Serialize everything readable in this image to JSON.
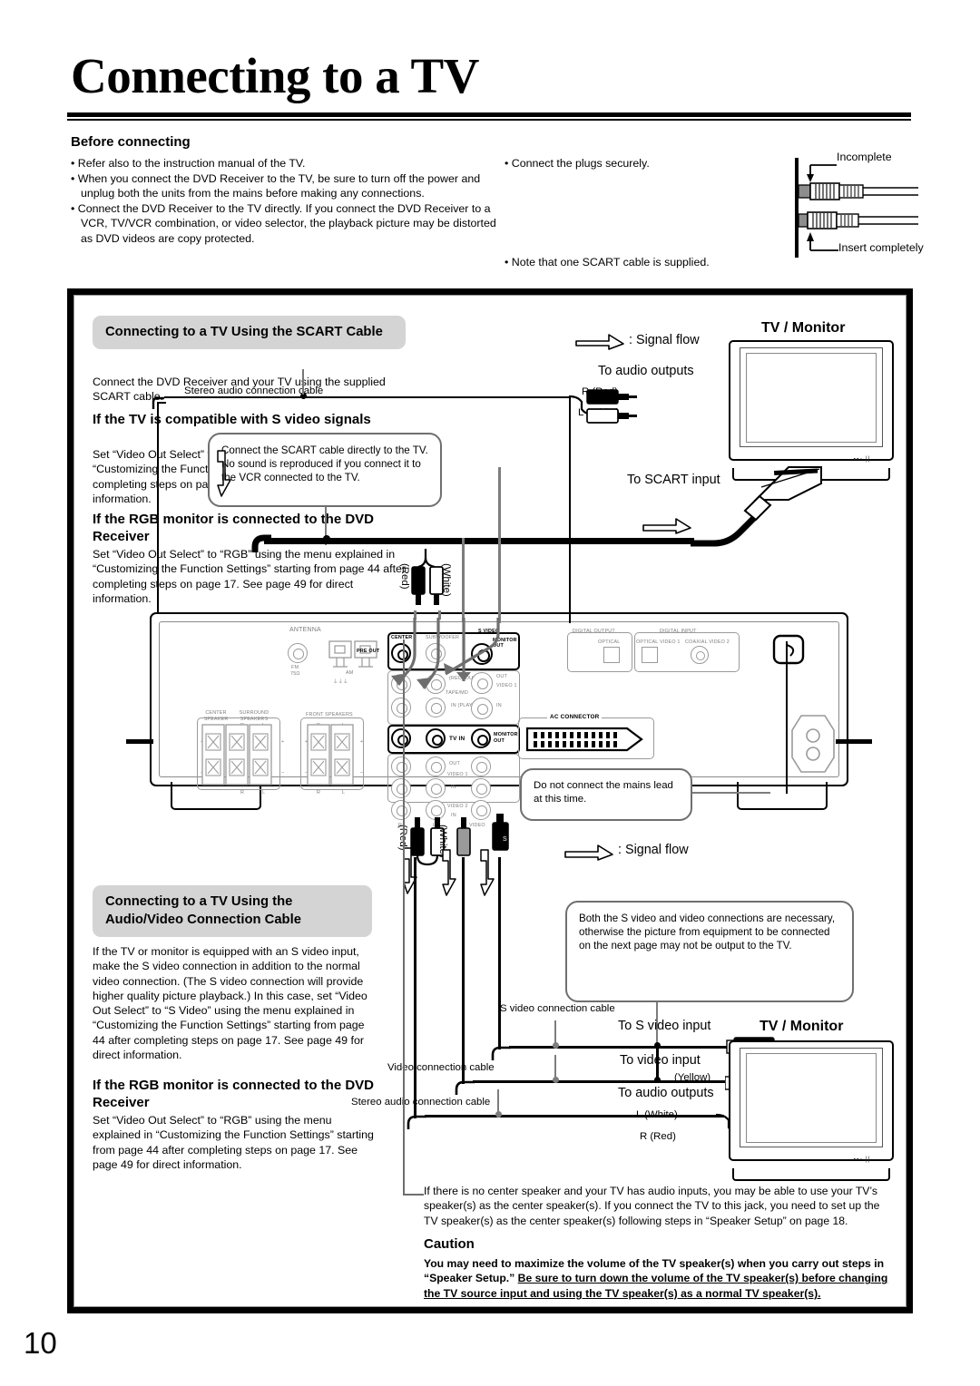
{
  "page": {
    "title": "Connecting to a TV",
    "number": "10"
  },
  "before_connecting": {
    "heading": "Before connecting",
    "left_bullets": [
      "Refer also to the instruction manual of the TV.",
      "When you connect the DVD Receiver to the TV, be sure to turn off the power and unplug both the units from the mains before making any connections.",
      "Connect the DVD Receiver to the TV directly. If you connect the DVD Receiver to a VCR, TV/VCR combination, or video selector, the playback picture may be distorted as DVD videos are copy protected."
    ],
    "right_bullets": [
      "Connect the plugs securely.",
      "Note that one SCART cable is supplied."
    ],
    "plug_diagram": {
      "incomplete_label": "Incomplete",
      "complete_label": "Insert completely"
    }
  },
  "scart_section": {
    "heading": "Connecting to a TV Using the SCART Cable",
    "intro": "Connect the DVD Receiver and your TV using the supplied SCART cable.",
    "sub1_heading": "If the TV is compatible with S video signals",
    "sub1_body": "Set “Video Out Select” to “S Video” using the menu explained in “Customizing the Function Settings” starting from page 44 after completing steps on page 17. See page 49 for direct information.",
    "sub2_heading": "If the RGB monitor is connected to the DVD Receiver",
    "sub2_body": "Set “Video Out Select” to “RGB” using the menu explained in “Customizing the Function Settings” starting from page 44 after completing steps on page 17. See page 49 for direct information."
  },
  "av_section": {
    "heading": "Connecting to a TV Using the Audio/Video Connection Cable",
    "intro": "If the TV or monitor is equipped with an S video input, make the S video connection in addition to the normal video connection. (The S video connection will provide higher quality picture playback.) In this case, set “Video Out Select” to “S Video” using the menu explained in “Customizing the Function Settings” starting from page 44 after completing steps on page 17. See page 49 for direct information.",
    "sub1_heading": "If the RGB monitor is connected to the DVD Receiver",
    "sub1_body": "Set “Video Out Select” to “RGB” using the menu explained in “Customizing the Function Settings” starting from page 44 after completing steps on page 17. See page 49 for direct information."
  },
  "diagram_top": {
    "signal_flow": ": Signal flow",
    "tv_monitor": "TV / Monitor",
    "stereo_cable": "Stereo audio connection cable",
    "to_audio_outputs": "To audio outputs",
    "r_red": "R (Red)",
    "l_white": "L (White)",
    "to_scart_input": "To SCART input",
    "callout": "Connect the SCART cable directly to the TV. No sound is reproduced if you connect it to the VCR connected to the TV.",
    "plug_red": "(Red)",
    "plug_white": "(White)"
  },
  "diagram_bottom": {
    "signal_flow": ": Signal flow",
    "tv_monitor": "TV / Monitor",
    "callout": "Both the S video and video connections are necessary, otherwise the picture from equipment to be connected on the next page may not be output to the TV.",
    "s_video_cable": "S video connection cable",
    "video_cable": "Video connection cable",
    "stereo_cable": "Stereo audio connection cable",
    "to_s_video_input": "To S video input",
    "to_video_input": "To video input",
    "yellow": "(Yellow)",
    "to_audio_outputs": "To audio outputs",
    "l_white": "L (White)",
    "r_red": "R (Red)",
    "plug_red": "(Red)",
    "plug_white": "(White)"
  },
  "receiver": {
    "mains_callout": "Do not connect the mains lead at this time.",
    "labels": {
      "antenna": "ANTENNA",
      "fm": "FM",
      "fm_ohm": "75Ω",
      "am": "AM",
      "center": "CENTER",
      "subwoofer": "SUBWOOFER",
      "pre_out": "PRE OUT",
      "s_video": "S VIDEO",
      "monitor_out": "MONITOR OUT",
      "rec_out": "(REC) OUT",
      "tape_md": "TAPE/MD",
      "in_play": "IN (PLAY)",
      "video_1": "VIDEO 1",
      "video_2": "VIDEO 2",
      "in": "IN",
      "out": "OUT",
      "tv_in": "TV  IN",
      "center_speaker": "CENTER SPEAKER",
      "surround_speakers": "SURROUND SPEAKERS",
      "front_speakers": "FRONT SPEAKERS",
      "r": "R",
      "l": "L",
      "video": "VIDEO",
      "digital_output": "DIGITAL OUTPUT",
      "digital_input": "DIGITAL INPUT",
      "optical": "OPTICAL",
      "optical_video1": "OPTICAL VIDEO 1",
      "coaxial_video2": "COAXIAL VIDEO 2",
      "ac_connector": "AC CONNECTOR"
    }
  },
  "footer": {
    "note": "If there is no center speaker and your TV has audio inputs, you may be able to use your TV’s speaker(s) as the center speaker(s). If you connect the TV to this jack, you need to set up the TV speaker(s) as the center speaker(s) following steps in “Speaker Setup” on page 18.",
    "caution_heading": "Caution",
    "caution_body_plain": "You may need to maximize the volume of the TV speaker(s) when you carry out steps in “Speaker Setup.” ",
    "caution_body_underline": "Be sure to turn down the volume of the TV speaker(s) before changing the TV source input and using the TV speaker(s) as a normal TV speaker(s)."
  }
}
